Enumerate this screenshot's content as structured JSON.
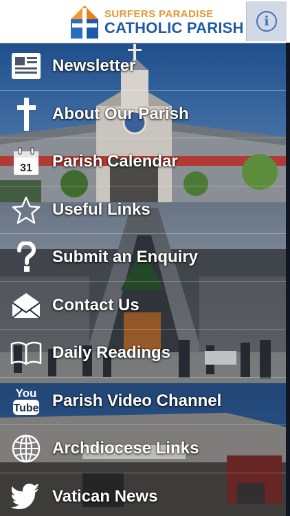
{
  "header": {
    "logo_line1": "SURFERS PARADISE",
    "logo_line2": "CATHOLIC PARISH",
    "info_icon": "info-icon",
    "info_glyph": "i"
  },
  "colors": {
    "logo_orange": "#e8962e",
    "logo_blue": "#1e5aa8",
    "info_blue": "#3f6fb6",
    "menu_text": "#ffffff"
  },
  "menu": {
    "items": [
      {
        "label": "Newsletter",
        "icon": "newsletter-icon"
      },
      {
        "label": "About Our Parish",
        "icon": "cross-icon"
      },
      {
        "label": "Parish Calendar",
        "icon": "calendar-icon",
        "icon_text": "31"
      },
      {
        "label": "Useful Links",
        "icon": "star-icon"
      },
      {
        "label": "Submit an Enquiry",
        "icon": "question-icon"
      },
      {
        "label": "Contact Us",
        "icon": "envelope-icon"
      },
      {
        "label": "Daily Readings",
        "icon": "book-icon"
      },
      {
        "label": "Parish Video Channel",
        "icon": "youtube-icon",
        "icon_text_top": "You",
        "icon_text_bottom": "Tube"
      },
      {
        "label": "Archdiocese Links",
        "icon": "globe-icon"
      },
      {
        "label": "Vatican News",
        "icon": "twitter-bird-icon"
      }
    ]
  }
}
